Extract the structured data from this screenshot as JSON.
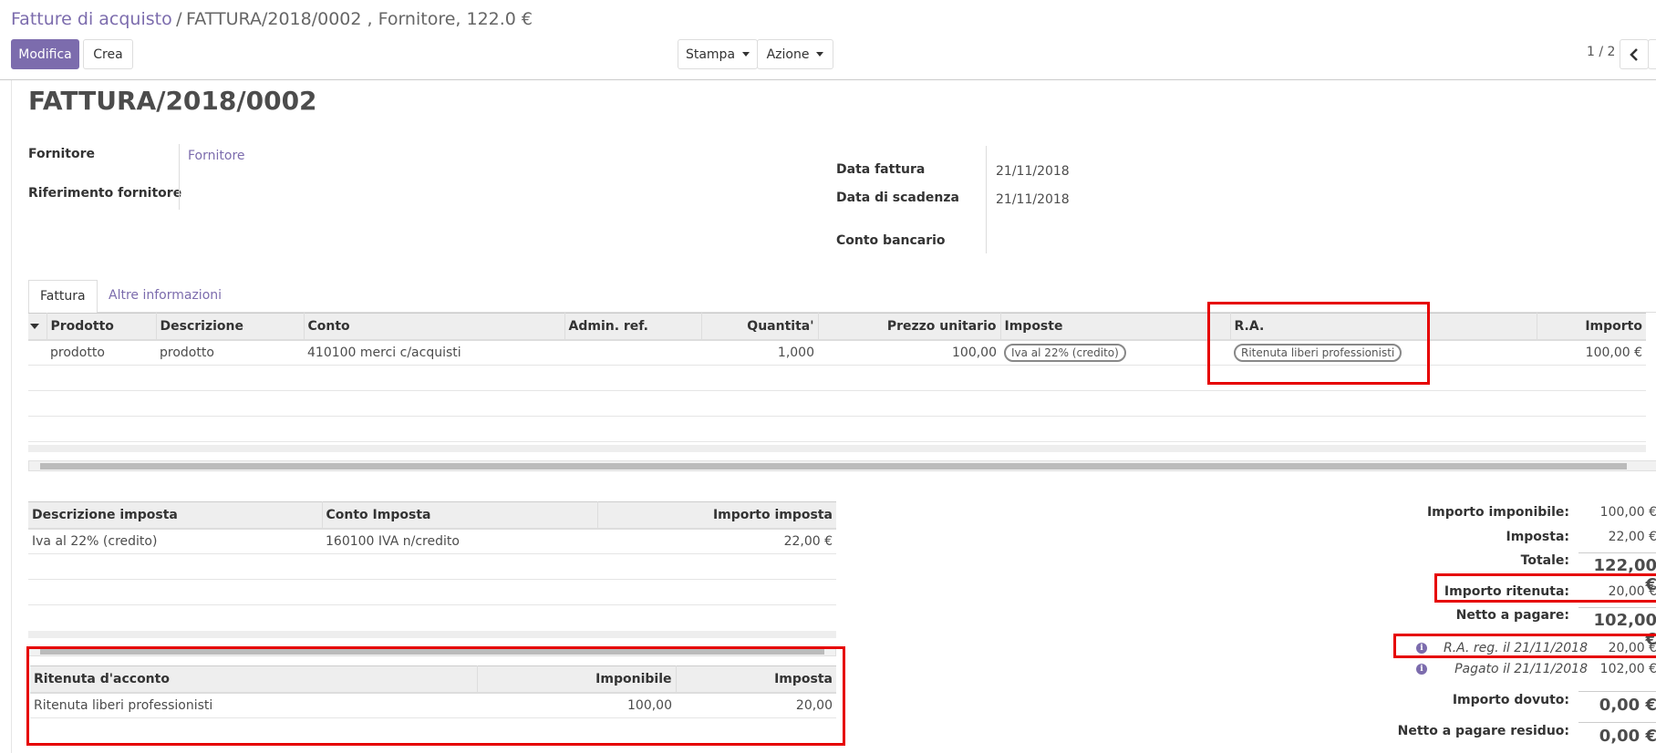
{
  "breadcrumb": {
    "parent": "Fatture di acquisto",
    "separator": "/",
    "current": "FATTURA/2018/0002 , Fornitore, 122.0 €"
  },
  "toolbar": {
    "edit_label": "Modifica",
    "create_label": "Crea",
    "print_label": "Stampa",
    "action_label": "Azione",
    "pager": "1 / 2"
  },
  "form": {
    "title": "FATTURA/2018/0002",
    "supplier_label": "Fornitore",
    "supplier_value": "Fornitore",
    "supplier_ref_label": "Riferimento fornitore",
    "invoice_date_label": "Data fattura",
    "invoice_date_value": "21/11/2018",
    "due_date_label": "Data di scadenza",
    "due_date_value": "21/11/2018",
    "bank_account_label": "Conto bancario"
  },
  "tabs": [
    {
      "label": "Fattura"
    },
    {
      "label": "Altre informazioni"
    }
  ],
  "lines_table": {
    "headers": [
      "Prodotto",
      "Descrizione",
      "Conto",
      "Admin. ref.",
      "Quantita'",
      "Prezzo unitario",
      "Imposte",
      "R.A.",
      "Importo"
    ],
    "rows": [
      {
        "product": "prodotto",
        "description": "prodotto",
        "account": "410100 merci c/acquisti",
        "admin_ref": "",
        "quantity": "1,000",
        "unit_price": "100,00",
        "taxes": "Iva al 22% (credito)",
        "ra": "Ritenuta liberi professionisti",
        "amount": "100,00 €"
      }
    ]
  },
  "tax_table": {
    "headers": [
      "Descrizione imposta",
      "Conto Imposta",
      "Importo imposta"
    ],
    "rows": [
      {
        "description": "Iva al 22% (credito)",
        "account": "160100 IVA n/credito",
        "amount": "22,00 €"
      }
    ]
  },
  "withholding_table": {
    "headers": [
      "Ritenuta d'acconto",
      "Imponibile",
      "Imposta"
    ],
    "rows": [
      {
        "name": "Ritenuta liberi professionisti",
        "base": "100,00",
        "tax": "20,00"
      }
    ]
  },
  "totals": {
    "untaxed_label": "Importo imponibile:",
    "untaxed_value": "100,00 €",
    "tax_label": "Imposta:",
    "tax_value": "22,00 €",
    "total_label": "Totale:",
    "total_value": "122,00 €",
    "withholding_label": "Importo ritenuta:",
    "withholding_value": "20,00 €",
    "net_label": "Netto a pagare:",
    "net_value": "102,00 €",
    "payment1_label": "R.A. reg. il 21/11/2018",
    "payment1_value": "20,00 €",
    "payment2_label": "Pagato il 21/11/2018",
    "payment2_value": "102,00 €",
    "due_label": "Importo dovuto:",
    "due_value": "0,00 €",
    "net_residual_label": "Netto a pagare residuo:",
    "net_residual_value": "0,00 €"
  },
  "colors": {
    "brand": "#7c6cad",
    "highlight": "#e60000"
  },
  "icons": {
    "prev": "chevron-left-icon",
    "info": "info-icon",
    "sort": "caret-down-icon"
  }
}
